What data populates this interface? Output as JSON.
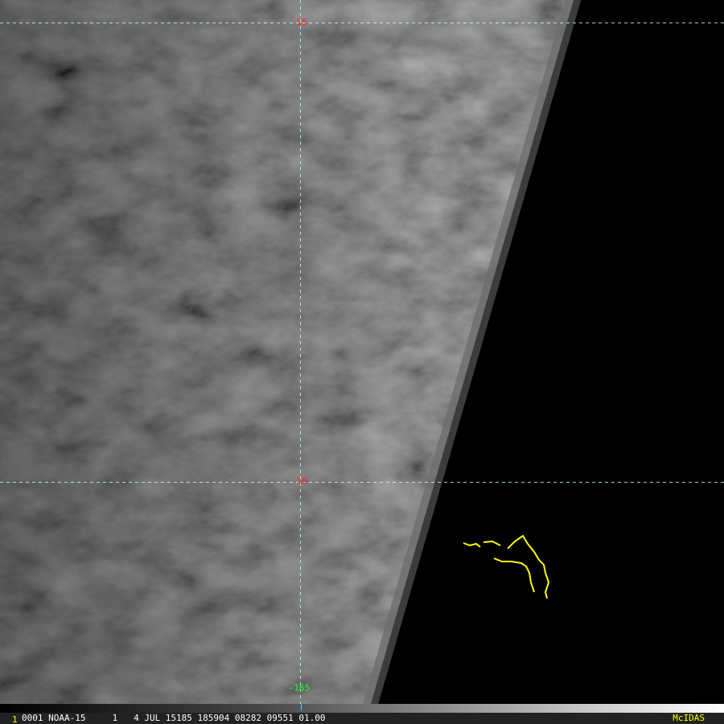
{
  "grid": {
    "lat_labels": [
      "15",
      "10"
    ],
    "lon_labels": [
      "-165"
    ],
    "line_color": "#00ffff",
    "lat_label_color": "#ff2020",
    "lon_label_color": "#20ff20"
  },
  "coast_color": "#ffff00",
  "status_bar": {
    "frame_number": "1",
    "info": "0001 NOAA-15     1   4 JUL 15185 185904 08282 09551 01.00",
    "brand": "McIDAS"
  }
}
